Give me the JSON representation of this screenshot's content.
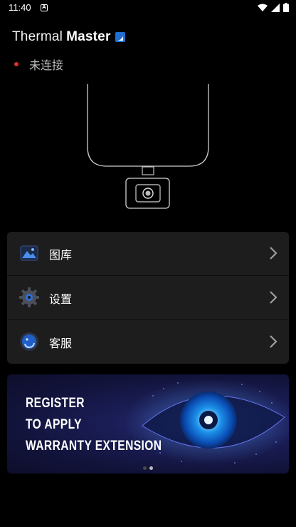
{
  "status_bar": {
    "time": "11:40",
    "notification_letter": "A",
    "icons": [
      "wifi-icon",
      "signal-icon",
      "battery-icon"
    ]
  },
  "brand": {
    "name_light": "Thermal",
    "name_bold": "Master"
  },
  "connection": {
    "status_text": "未连接",
    "status_color": "#e0302a"
  },
  "menu": {
    "items": [
      {
        "label": "图库",
        "icon": "gallery-icon"
      },
      {
        "label": "设置",
        "icon": "settings-gear-icon"
      },
      {
        "label": "客服",
        "icon": "customer-service-icon"
      }
    ]
  },
  "banner": {
    "lines": [
      "REGISTER",
      "TO APPLY",
      "WARRANTY EXTENSION"
    ],
    "page_count": 2,
    "active_page": 2
  },
  "colors": {
    "background": "#000000",
    "card": "#1d1d1d",
    "accent": "#1f6fd1"
  }
}
